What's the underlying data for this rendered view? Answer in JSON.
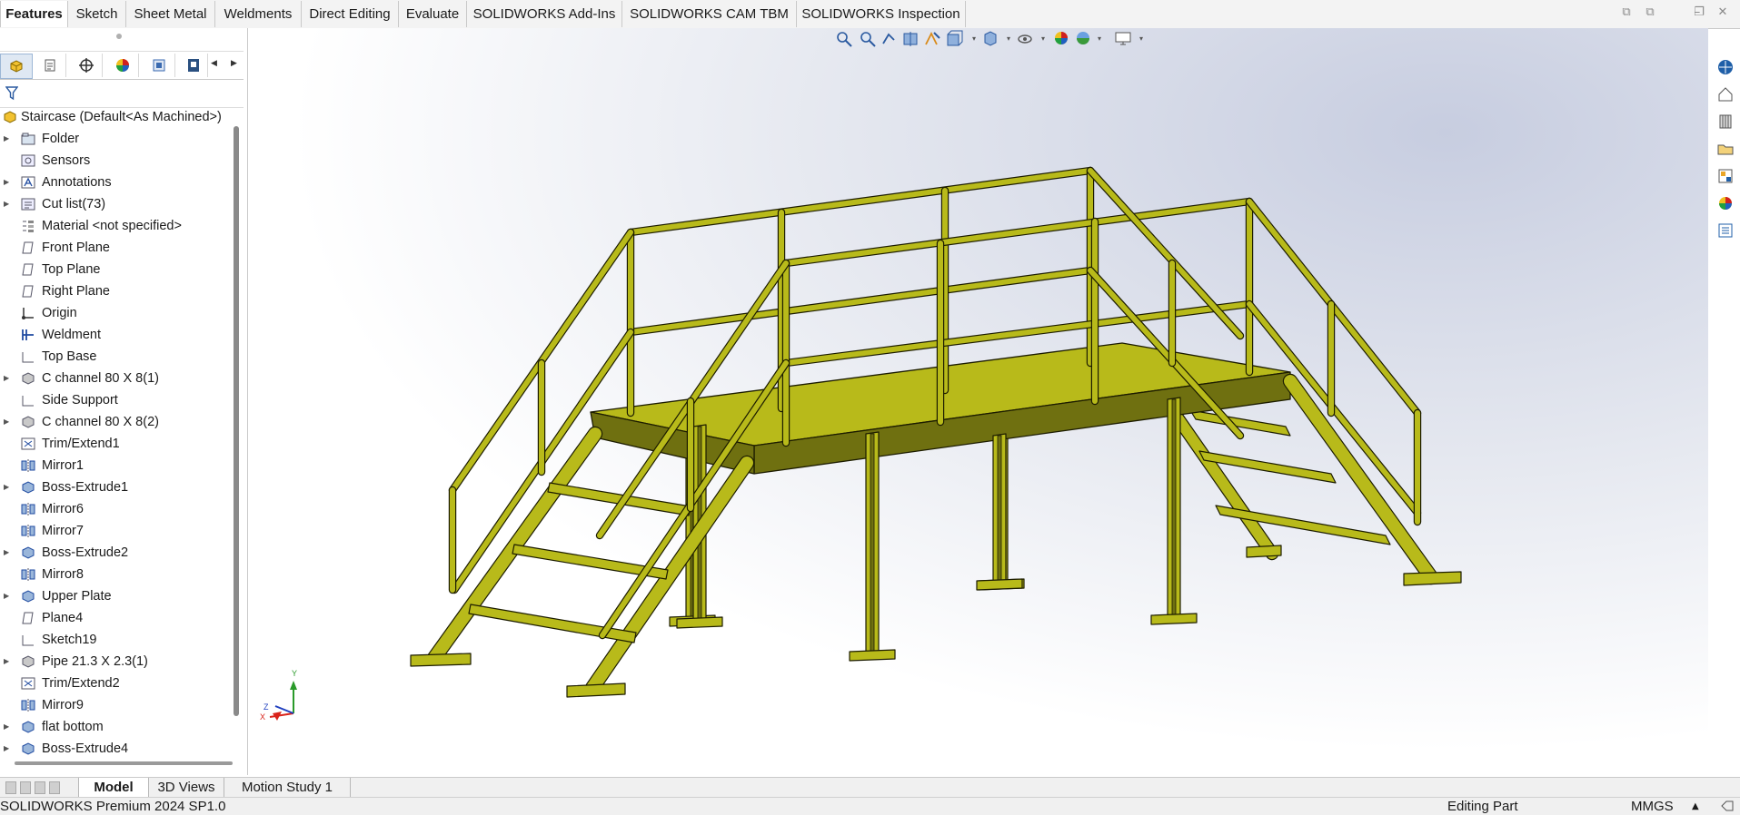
{
  "command_manager": {
    "tabs": [
      "Features",
      "Sketch",
      "Sheet Metal",
      "Weldments",
      "Direct Editing",
      "Evaluate",
      "SOLIDWORKS Add-Ins",
      "SOLIDWORKS CAM TBM",
      "SOLIDWORKS Inspection"
    ],
    "active_tab": "Features"
  },
  "feature_tree": {
    "root": "Staircase  (Default<As Machined>)",
    "items": [
      {
        "label": "Folder",
        "icon": "folder-icon",
        "expandable": true
      },
      {
        "label": "Sensors",
        "icon": "sensor-icon",
        "expandable": false
      },
      {
        "label": "Annotations",
        "icon": "annotations-icon",
        "expandable": true
      },
      {
        "label": "Cut list(73)",
        "icon": "cut-list-icon",
        "expandable": true
      },
      {
        "label": "Material <not specified>",
        "icon": "material-icon",
        "expandable": false
      },
      {
        "label": "Front Plane",
        "icon": "plane-icon",
        "expandable": false
      },
      {
        "label": "Top Plane",
        "icon": "plane-icon",
        "expandable": false
      },
      {
        "label": "Right Plane",
        "icon": "plane-icon",
        "expandable": false
      },
      {
        "label": "Origin",
        "icon": "origin-icon",
        "expandable": false
      },
      {
        "label": "Weldment",
        "icon": "weldment-icon",
        "expandable": false
      },
      {
        "label": "Top Base",
        "icon": "sketch-icon",
        "expandable": false
      },
      {
        "label": "C channel 80 X 8(1)",
        "icon": "structural-member-icon",
        "expandable": true
      },
      {
        "label": "Side Support",
        "icon": "sketch-icon",
        "expandable": false
      },
      {
        "label": "C channel 80 X 8(2)",
        "icon": "structural-member-icon",
        "expandable": true
      },
      {
        "label": "Trim/Extend1",
        "icon": "trim-extend-icon",
        "expandable": false
      },
      {
        "label": "Mirror1",
        "icon": "mirror-icon",
        "expandable": false
      },
      {
        "label": "Boss-Extrude1",
        "icon": "extrude-icon",
        "expandable": true
      },
      {
        "label": "Mirror6",
        "icon": "mirror-icon",
        "expandable": false
      },
      {
        "label": "Mirror7",
        "icon": "mirror-icon",
        "expandable": false
      },
      {
        "label": "Boss-Extrude2",
        "icon": "extrude-icon",
        "expandable": true
      },
      {
        "label": "Mirror8",
        "icon": "mirror-icon",
        "expandable": false
      },
      {
        "label": "Upper Plate",
        "icon": "extrude-icon",
        "expandable": true
      },
      {
        "label": "Plane4",
        "icon": "plane-icon",
        "expandable": false
      },
      {
        "label": "Sketch19",
        "icon": "sketch-icon",
        "expandable": false
      },
      {
        "label": "Pipe 21.3 X 2.3(1)",
        "icon": "structural-member-icon",
        "expandable": true
      },
      {
        "label": "Trim/Extend2",
        "icon": "trim-extend-icon",
        "expandable": false
      },
      {
        "label": "Mirror9",
        "icon": "mirror-icon",
        "expandable": false
      },
      {
        "label": "flat bottom",
        "icon": "extrude-icon",
        "expandable": true
      },
      {
        "label": "Boss-Extrude4",
        "icon": "extrude-icon",
        "expandable": true
      }
    ]
  },
  "bottom_tabs": {
    "items": [
      "Model",
      "3D Views",
      "Motion Study 1"
    ],
    "active": "Model"
  },
  "status_bar": {
    "app": "SOLIDWORKS Premium 2024 SP1.0",
    "mode": "Editing Part",
    "units": "MMGS",
    "units_arrow": "▲"
  },
  "triad": {
    "y": "Y",
    "z": "Z",
    "x": "X"
  },
  "colors": {
    "model_fill": "#b8ba1a",
    "model_dark": "#6f7010",
    "model_edge": "#1c1c00",
    "accent_blue": "#1f5fa8",
    "triad_red": "#d9231b",
    "triad_green": "#2a9a2a",
    "triad_blue": "#1f3fbf"
  }
}
